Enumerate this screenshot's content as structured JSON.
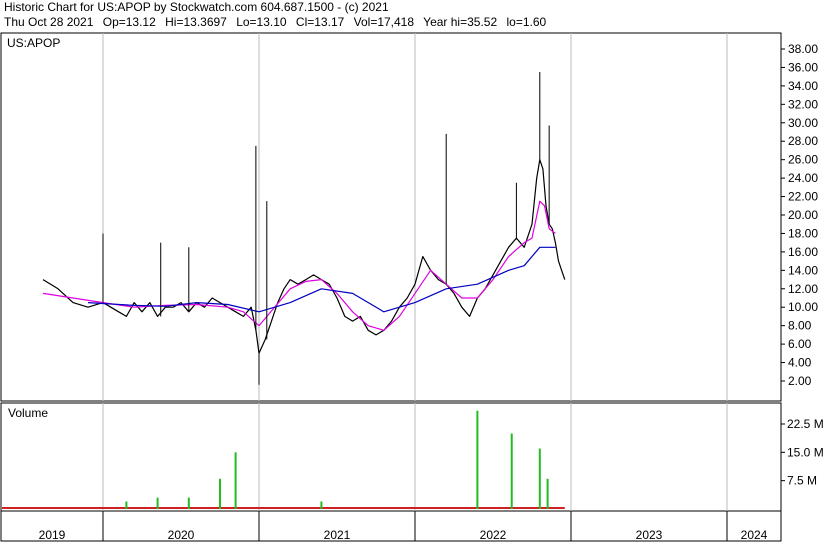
{
  "header": {
    "title": "Historic Chart for US:APOP by Stockwatch.com 604.687.1500 - (c) 2021",
    "date": "Thu Oct 28 2021",
    "open": "Op=13.12",
    "high": "Hi=13.3697",
    "low": "Lo=13.10",
    "close": "Cl=13.17",
    "volume": "Vol=17,418",
    "year_high": "Year hi=35.52",
    "year_low": "lo=1.60"
  },
  "colors": {
    "price": "#000000",
    "ma_short": "#e000e0",
    "ma_long": "#0000c0",
    "volume_up": "#22bb22",
    "volume_down": "#cc2222",
    "grid": "#bbbbbb"
  },
  "chart_data": [
    {
      "type": "line",
      "title": "US:APOP",
      "ylim": [
        0,
        39.5
      ],
      "y_ticks": [
        "38.00",
        "36.00",
        "34.00",
        "32.00",
        "30.00",
        "28.00",
        "26.00",
        "24.00",
        "22.00",
        "20.00",
        "18.00",
        "16.00",
        "14.00",
        "12.00",
        "10.00",
        "8.00",
        "6.00",
        "4.00",
        "2.00"
      ],
      "x_ticks": [
        "2019",
        "2020",
        "2021",
        "2022",
        "2023",
        "2024"
      ],
      "series": [
        {
          "values": [
            [
              2018.8,
              13.0
            ],
            [
              2018.85,
              12.0
            ],
            [
              2018.9,
              10.5
            ],
            [
              2018.95,
              10.0
            ],
            [
              2019.0,
              10.5
            ],
            [
              2019.05,
              10.0
            ],
            [
              2019.1,
              9.5
            ],
            [
              2019.15,
              9.0
            ],
            [
              2019.2,
              10.5
            ],
            [
              2019.25,
              9.5
            ],
            [
              2019.3,
              10.5
            ],
            [
              2019.35,
              9.0
            ],
            [
              2019.4,
              10.0
            ],
            [
              2019.45,
              10.0
            ],
            [
              2019.5,
              10.5
            ],
            [
              2019.55,
              9.5
            ],
            [
              2019.6,
              10.5
            ],
            [
              2019.65,
              10.0
            ],
            [
              2019.7,
              11.0
            ],
            [
              2019.75,
              10.5
            ],
            [
              2019.8,
              10.0
            ],
            [
              2019.85,
              9.5
            ],
            [
              2019.9,
              9.0
            ],
            [
              2019.95,
              10.0
            ],
            [
              2019.98,
              7.5
            ],
            [
              2020.0,
              5.0
            ],
            [
              2020.04,
              6.5
            ],
            [
              2020.08,
              8.5
            ],
            [
              2020.12,
              10.5
            ],
            [
              2020.16,
              12.0
            ],
            [
              2020.2,
              13.0
            ],
            [
              2020.25,
              12.5
            ],
            [
              2020.3,
              13.0
            ],
            [
              2020.35,
              13.5
            ],
            [
              2020.4,
              13.0
            ],
            [
              2020.45,
              12.5
            ],
            [
              2020.5,
              11.0
            ],
            [
              2020.55,
              9.0
            ],
            [
              2020.6,
              8.5
            ],
            [
              2020.65,
              9.0
            ],
            [
              2020.7,
              7.5
            ],
            [
              2020.75,
              7.0
            ],
            [
              2020.8,
              7.5
            ],
            [
              2020.85,
              8.5
            ],
            [
              2020.9,
              10.0
            ],
            [
              2020.95,
              11.0
            ],
            [
              2021.0,
              12.5
            ],
            [
              2021.05,
              15.5
            ],
            [
              2021.1,
              14.0
            ],
            [
              2021.15,
              13.0
            ],
            [
              2021.2,
              12.5
            ],
            [
              2021.25,
              11.5
            ],
            [
              2021.3,
              10.0
            ],
            [
              2021.35,
              9.0
            ],
            [
              2021.4,
              11.0
            ],
            [
              2021.45,
              12.0
            ],
            [
              2021.5,
              13.5
            ],
            [
              2021.55,
              15.0
            ],
            [
              2021.6,
              16.5
            ],
            [
              2021.65,
              17.5
            ],
            [
              2021.7,
              16.5
            ],
            [
              2021.75,
              19.0
            ],
            [
              2021.78,
              24.0
            ],
            [
              2021.8,
              26.0
            ],
            [
              2021.82,
              25.0
            ],
            [
              2021.84,
              21.0
            ],
            [
              2021.86,
              19.0
            ],
            [
              2021.88,
              18.5
            ],
            [
              2021.9,
              17.0
            ],
            [
              2021.92,
              15.0
            ],
            [
              2021.94,
              14.0
            ],
            [
              2021.96,
              13.0
            ]
          ]
        },
        {
          "values": [
            [
              2018.8,
              11.5
            ],
            [
              2019.0,
              10.5
            ],
            [
              2019.2,
              10.0
            ],
            [
              2019.4,
              10.2
            ],
            [
              2019.6,
              10.3
            ],
            [
              2019.8,
              10.0
            ],
            [
              2019.9,
              9.5
            ],
            [
              2020.0,
              8.0
            ],
            [
              2020.1,
              10.0
            ],
            [
              2020.2,
              12.0
            ],
            [
              2020.3,
              12.8
            ],
            [
              2020.4,
              13.0
            ],
            [
              2020.5,
              11.5
            ],
            [
              2020.6,
              9.5
            ],
            [
              2020.7,
              8.0
            ],
            [
              2020.8,
              7.5
            ],
            [
              2020.9,
              9.0
            ],
            [
              2021.0,
              11.5
            ],
            [
              2021.1,
              14.0
            ],
            [
              2021.2,
              12.5
            ],
            [
              2021.3,
              11.0
            ],
            [
              2021.4,
              11.0
            ],
            [
              2021.5,
              13.0
            ],
            [
              2021.6,
              15.5
            ],
            [
              2021.7,
              17.0
            ],
            [
              2021.75,
              17.5
            ],
            [
              2021.8,
              21.5
            ],
            [
              2021.83,
              21.0
            ],
            [
              2021.86,
              18.5
            ],
            [
              2021.9,
              18.0
            ]
          ]
        },
        {
          "values": [
            [
              2018.95,
              10.5
            ],
            [
              2019.2,
              10.2
            ],
            [
              2019.4,
              10.1
            ],
            [
              2019.6,
              10.5
            ],
            [
              2019.8,
              10.3
            ],
            [
              2020.0,
              9.5
            ],
            [
              2020.2,
              10.5
            ],
            [
              2020.4,
              12.0
            ],
            [
              2020.6,
              11.5
            ],
            [
              2020.8,
              9.5
            ],
            [
              2021.0,
              10.5
            ],
            [
              2021.2,
              12.0
            ],
            [
              2021.4,
              12.5
            ],
            [
              2021.6,
              14.0
            ],
            [
              2021.7,
              14.5
            ],
            [
              2021.8,
              16.5
            ],
            [
              2021.9,
              16.5
            ]
          ]
        }
      ]
    },
    {
      "type": "bar",
      "title": "Volume",
      "ylim": [
        0,
        27
      ],
      "y_ticks": [
        "22.5 M",
        "15.0 M",
        "7.5 M"
      ],
      "series": [
        {
          "values": [
            [
              2019.15,
              2.0
            ],
            [
              2019.35,
              3.0
            ],
            [
              2019.55,
              3.0
            ],
            [
              2019.75,
              8.0
            ],
            [
              2019.85,
              15.0
            ],
            [
              2020.4,
              2.0
            ],
            [
              2021.4,
              26.0
            ],
            [
              2021.62,
              20.0
            ],
            [
              2021.8,
              16.0
            ],
            [
              2021.85,
              8.0
            ]
          ]
        }
      ]
    }
  ]
}
